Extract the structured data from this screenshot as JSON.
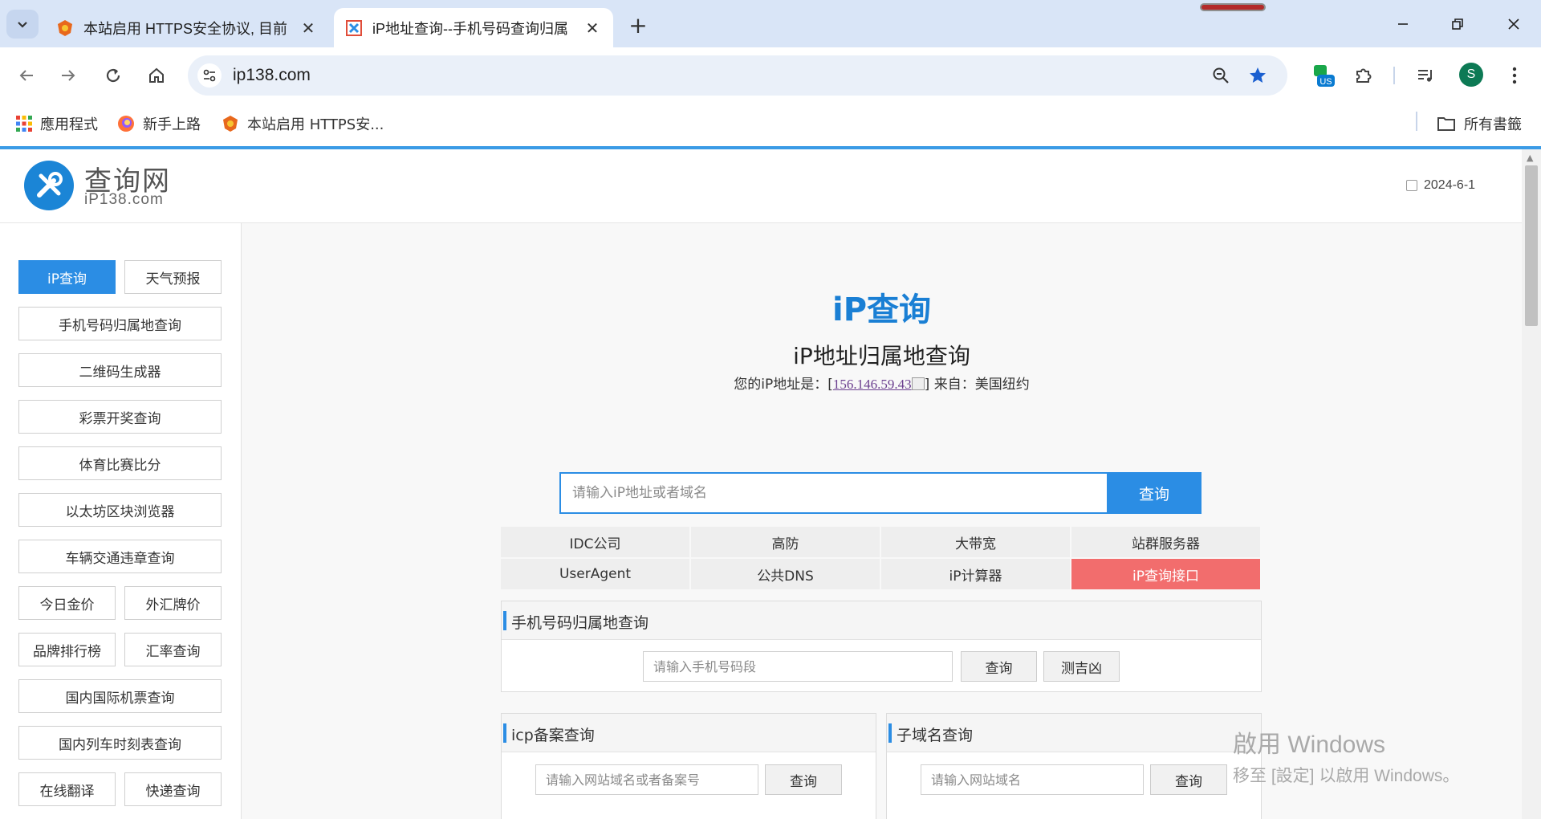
{
  "browser": {
    "tabs": [
      {
        "title": "本站启用 HTTPS安全协议, 目前",
        "active": false
      },
      {
        "title": "iP地址查询--手机号码查询归属",
        "active": true
      }
    ],
    "address": "ip138.com",
    "bookmarks": [
      "應用程式",
      "新手上路",
      "本站启用 HTTPS安..."
    ],
    "all_bookmarks": "所有書籤",
    "avatar_letter": "S",
    "extension_badge": "US"
  },
  "site": {
    "logo_cn": "查询网",
    "logo_en": "iP138.com",
    "date": "2024-6-1"
  },
  "sidebar": {
    "items": [
      {
        "label": "iP查询",
        "primary": true
      },
      {
        "label": "天气预报"
      },
      {
        "label": "手机号码归属地查询"
      },
      {
        "label": "二维码生成器"
      },
      {
        "label": "彩票开奖查询"
      },
      {
        "label": "体育比赛比分"
      },
      {
        "label": "以太坊区块浏览器"
      },
      {
        "label": "车辆交通违章查询"
      },
      {
        "label": "今日金价"
      },
      {
        "label": "外汇牌价"
      },
      {
        "label": "品牌排行榜"
      },
      {
        "label": "汇率查询"
      },
      {
        "label": "国内国际机票查询"
      },
      {
        "label": "国内列车时刻表查询"
      },
      {
        "label": "在线翻译"
      },
      {
        "label": "快递查询"
      }
    ]
  },
  "hero": {
    "title": "iP查询",
    "subtitle": "iP地址归属地查询",
    "ip_prefix": "您的iP地址是：[",
    "ip": "156.146.59.43",
    "ip_suffix": "] 来自：美国纽约"
  },
  "ip_search": {
    "placeholder": "请输入iP地址或者域名",
    "button": "查询"
  },
  "quick_links": [
    "IDC公司",
    "高防",
    "大带宽",
    "站群服务器",
    "UserAgent",
    "公共DNS",
    "iP计算器",
    "iP查询接口"
  ],
  "phone_panel": {
    "title": "手机号码归属地查询",
    "placeholder": "请输入手机号码段",
    "button": "查询",
    "button2": "测吉凶"
  },
  "icp_panel": {
    "title": "icp备案查询",
    "placeholder": "请输入网站域名或者备案号",
    "button": "查询"
  },
  "subdomain_panel": {
    "title": "子域名查询",
    "placeholder": "请输入网站域名",
    "button": "查询"
  },
  "watermark": {
    "line1": "啟用 Windows",
    "line2": "移至 [設定] 以啟用 Windows。"
  },
  "colors": {
    "accent": "#2b8de4",
    "hot": "#f26d6d",
    "brand": "#1a7fd4"
  }
}
